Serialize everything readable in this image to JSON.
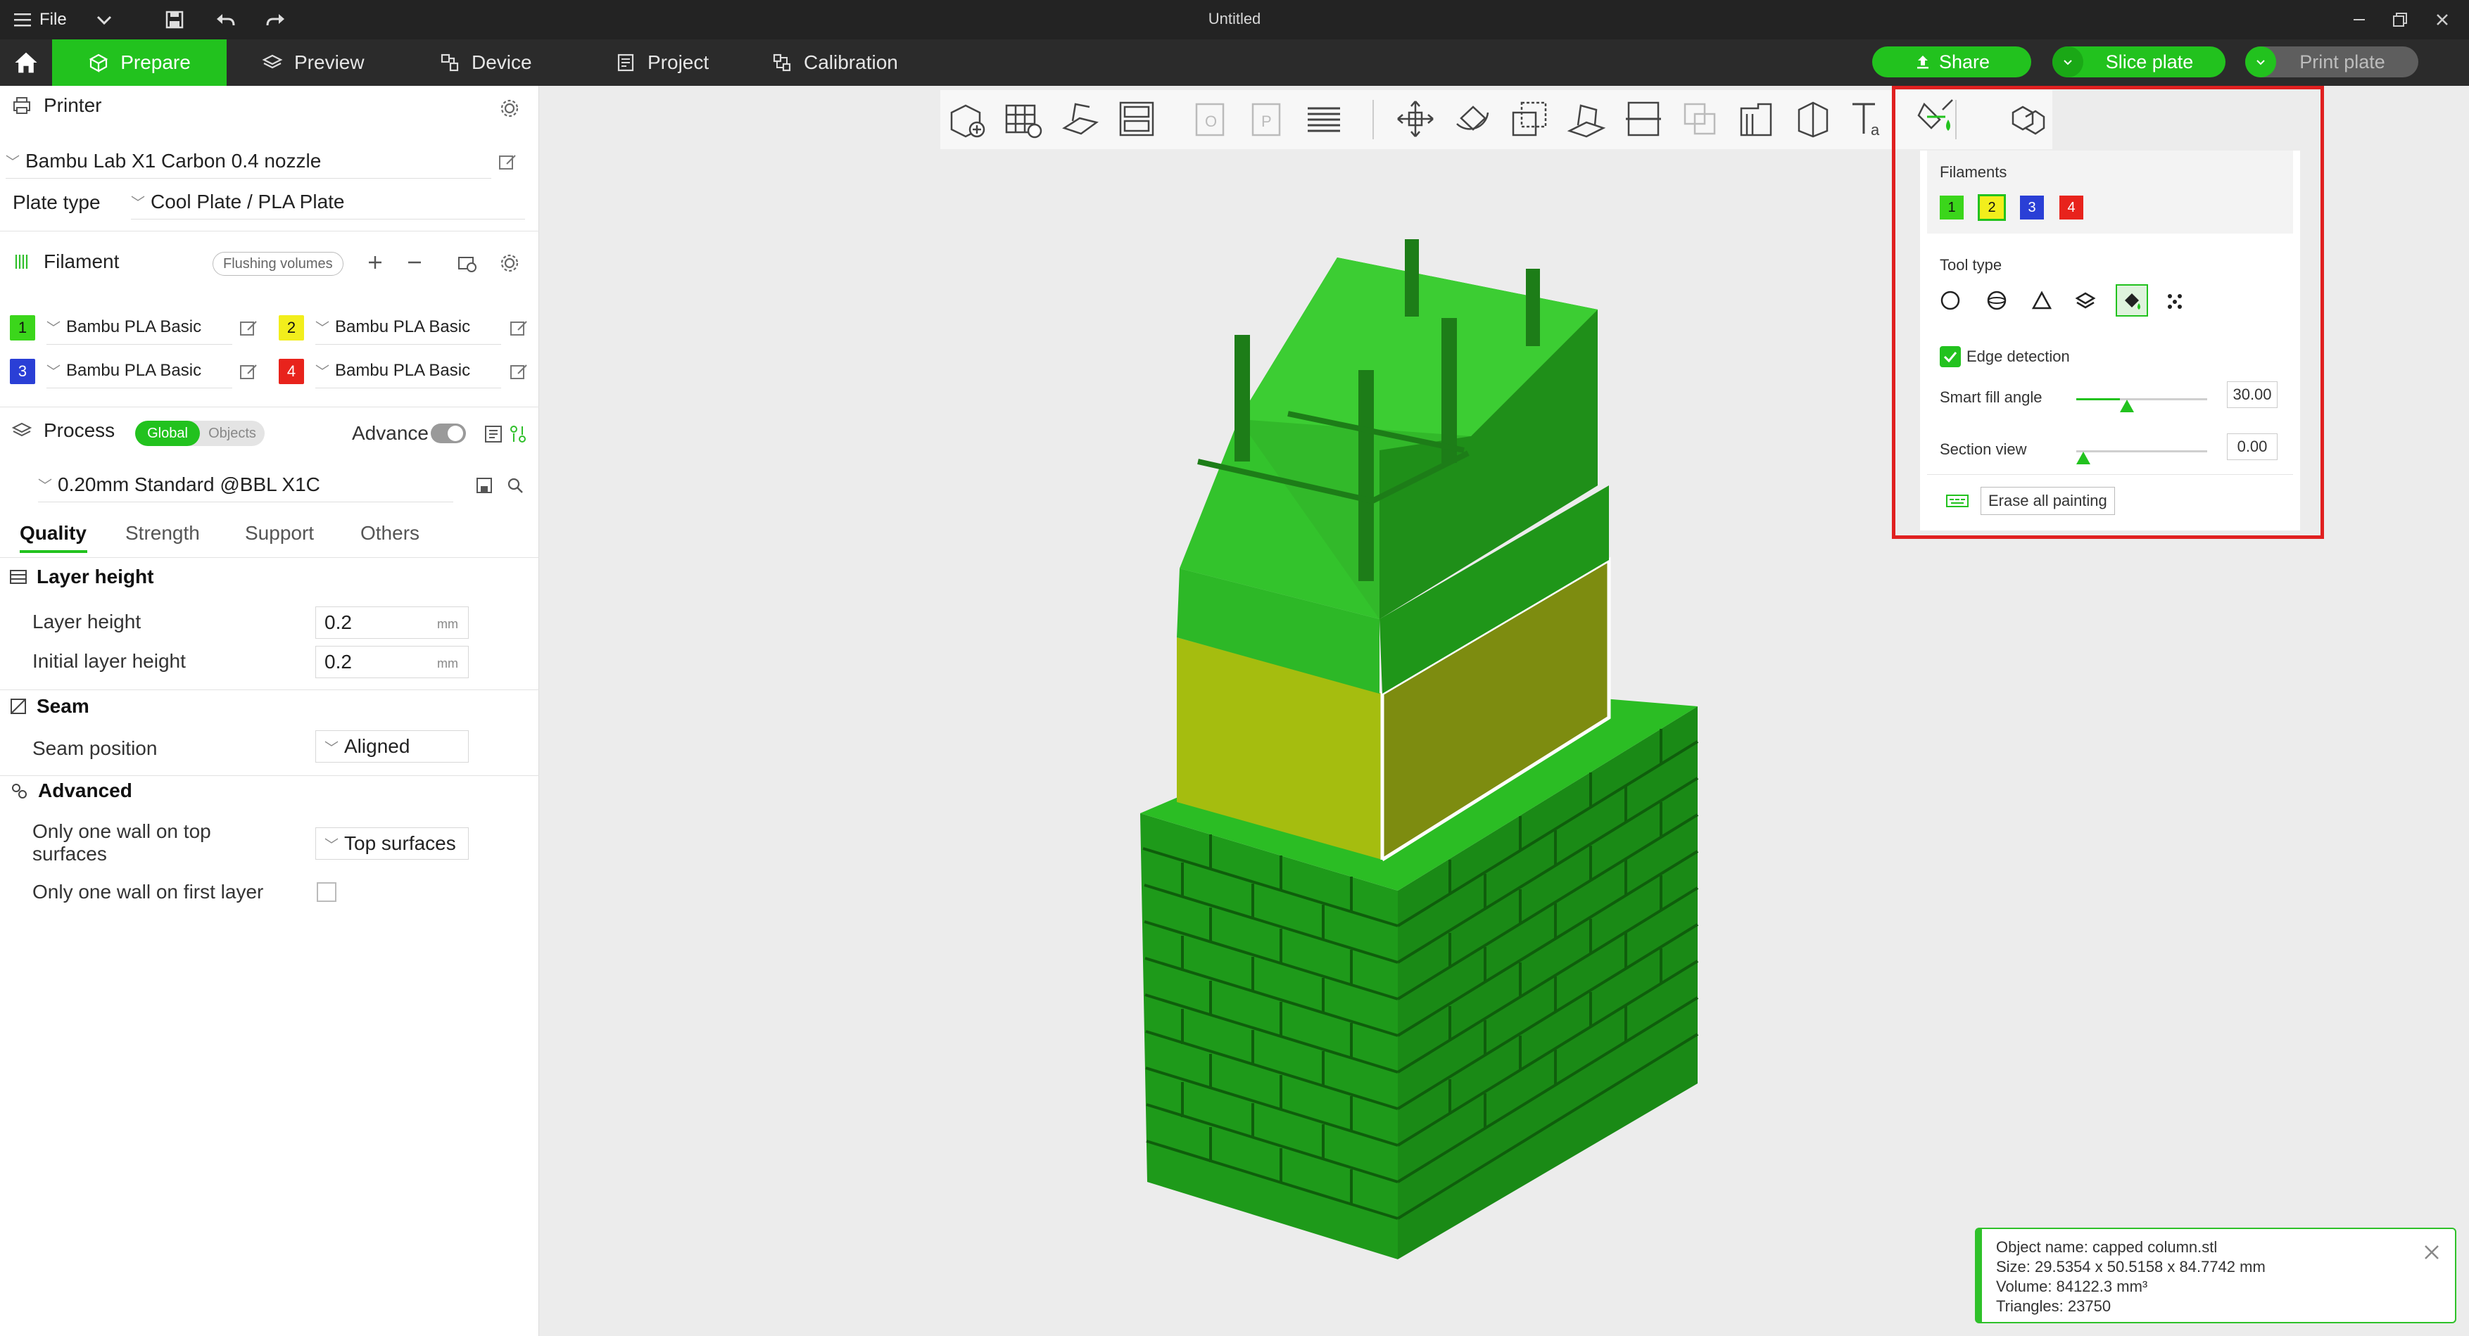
{
  "titlebar": {
    "file_label": "File",
    "window_title": "Untitled"
  },
  "tabs": [
    {
      "label": "Prepare",
      "icon": "cube-icon"
    },
    {
      "label": "Preview",
      "icon": "layers-icon"
    },
    {
      "label": "Device",
      "icon": "device-icon"
    },
    {
      "label": "Project",
      "icon": "project-icon"
    },
    {
      "label": "Calibration",
      "icon": "calibration-icon"
    }
  ],
  "actions": {
    "share": "Share",
    "slice": "Slice plate",
    "print": "Print plate"
  },
  "colors": {
    "accent": "#22c21e",
    "filament1": "#3bd61b",
    "filament2": "#f2ee1c",
    "filament3": "#2a3fd6",
    "filament4": "#e8231c",
    "highlight": "#e02020"
  },
  "printer": {
    "section": "Printer",
    "name": "Bambu Lab X1 Carbon 0.4 nozzle",
    "plate_type_label": "Plate type",
    "plate_type": "Cool Plate / PLA Plate"
  },
  "filament": {
    "section": "Filament",
    "flushing": "Flushing volumes",
    "items": [
      {
        "slot": "1",
        "name": "Bambu PLA Basic"
      },
      {
        "slot": "2",
        "name": "Bambu PLA Basic"
      },
      {
        "slot": "3",
        "name": "Bambu PLA Basic"
      },
      {
        "slot": "4",
        "name": "Bambu PLA Basic"
      }
    ]
  },
  "process": {
    "section": "Process",
    "global": "Global",
    "objects": "Objects",
    "advance": "Advance",
    "preset": "0.20mm Standard @BBL X1C",
    "tabs": [
      "Quality",
      "Strength",
      "Support",
      "Others"
    ]
  },
  "params": {
    "layer_height_group": "Layer height",
    "layer_height_label": "Layer height",
    "layer_height_value": "0.2",
    "initial_layer_height_label": "Initial layer height",
    "initial_layer_height_value": "0.2",
    "unit": "mm",
    "seam_group": "Seam",
    "seam_position_label": "Seam position",
    "seam_position_value": "Aligned",
    "advanced_group": "Advanced",
    "one_wall_top_label_1": "Only one wall on top",
    "one_wall_top_label_2": "surfaces",
    "one_wall_top_value": "Top surfaces",
    "one_wall_first_label": "Only one wall on first layer"
  },
  "paint": {
    "filaments_label": "Filaments",
    "chips": [
      "1",
      "2",
      "3",
      "4"
    ],
    "selected_chip": "2",
    "tool_type_label": "Tool type",
    "tools": [
      "circle-tool-icon",
      "sphere-tool-icon",
      "triangle-tool-icon",
      "height-range-tool-icon",
      "fill-bucket-tool-icon",
      "gap-fill-tool-icon"
    ],
    "selected_tool": "fill-bucket-tool-icon",
    "edge_detection": "Edge detection",
    "smart_fill_label": "Smart fill angle",
    "smart_fill_value": "30.00",
    "smart_fill_level": 0.3333,
    "section_view_label": "Section view",
    "section_view_value": "0.00",
    "section_view_level": 0.0,
    "erase_all": "Erase all painting"
  },
  "info": {
    "line1": "Object name: capped column.stl",
    "line2": "Size: 29.5354 x 50.5158 x 84.7742 mm",
    "line3": "Volume: 84122.3 mm³",
    "line4": "Triangles: 23750"
  }
}
